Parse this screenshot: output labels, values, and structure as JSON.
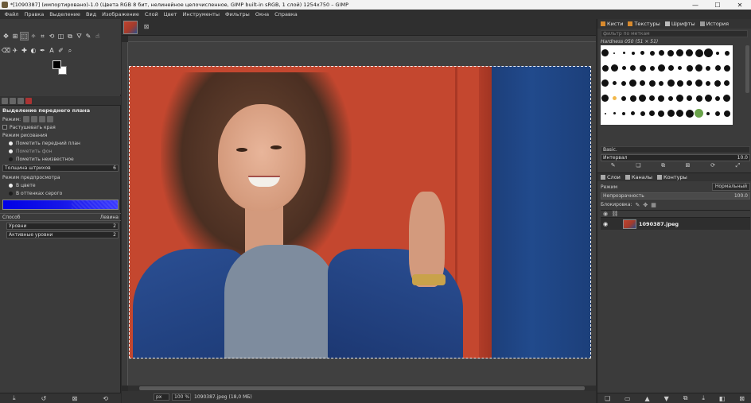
{
  "window": {
    "title": "*[1090387] (импортировано)-1.0 (Цвета RGB 8 бит, нелинейное целочисленное, GIMP built-in sRGB, 1 слой) 1254x750 – GIMP",
    "minimize": "—",
    "maximize": "☐",
    "close": "✕"
  },
  "menu": [
    "Файл",
    "Правка",
    "Выделение",
    "Вид",
    "Изображение",
    "Слой",
    "Цвет",
    "Инструменты",
    "Фильтры",
    "Окна",
    "Справка"
  ],
  "tool_options": {
    "title": "Выделение переднего плана",
    "mode_label": "Режим:",
    "antialias_label": "Растушевать края",
    "draw_mode_label": "Режим рисования",
    "draw_modes": [
      "Пометить передний план",
      "Пометить фон",
      "Пометить неизвестное"
    ],
    "stroke_width_label": "Толщина штрихов",
    "stroke_width_value": "6",
    "preview_mode_label": "Режим предпросмотра",
    "preview_modes": [
      "В цвете",
      "В оттенках серого"
    ],
    "method_label": "Способ",
    "method_value": "Левина",
    "levels_label": "Уровни",
    "levels_value": "2",
    "active_levels_label": "Активные уровни",
    "active_levels_value": "2"
  },
  "image_tab": {
    "close": "⊠"
  },
  "status": {
    "unit": "px",
    "zoom": "100 %",
    "file": "1090387.jpeg (18,0 МБ)"
  },
  "right_tabs": [
    "Кисти",
    "Текстуры",
    "Шрифты",
    "История"
  ],
  "brushes": {
    "filter_placeholder": "фильтр по меткам",
    "selected_name": "Hardness 050 (51 × 51)",
    "tag": "Basic.",
    "interval_label": "Интервал",
    "interval_value": "10.0"
  },
  "layers_tabs": [
    "Слои",
    "Каналы",
    "Контуры"
  ],
  "layers": {
    "mode_label": "Режим",
    "mode_value": "Нормальный",
    "opacity_label": "Непрозрачность",
    "opacity_value": "100.0",
    "lock_label": "Блокировка:",
    "items": [
      {
        "name": "1090387.jpeg"
      }
    ]
  }
}
